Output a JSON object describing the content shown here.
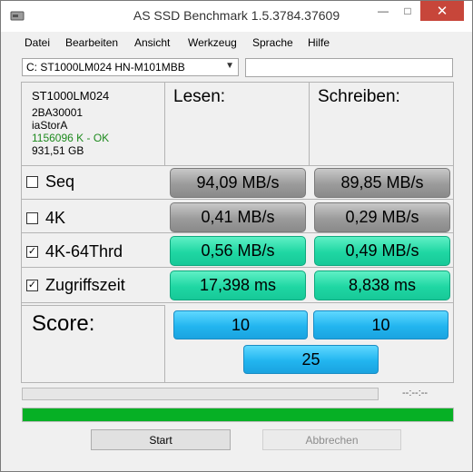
{
  "window": {
    "title": "AS SSD Benchmark 1.5.3784.37609"
  },
  "menu": [
    "Datei",
    "Bearbeiten",
    "Ansicht",
    "Werkzeug",
    "Sprache",
    "Hilfe"
  ],
  "drive_select": {
    "value": "C: ST1000LM024 HN-M101MBB"
  },
  "text_box": {
    "value": ""
  },
  "info": {
    "model": "ST1000LM024",
    "firmware": "2BA30001",
    "driver": "iaStorA",
    "alignment": "1156096 K - OK",
    "size": "931,51 GB"
  },
  "columns": {
    "read": "Lesen:",
    "write": "Schreiben:"
  },
  "rows": [
    {
      "label": "Seq",
      "checked": false,
      "read": "94,09 MB/s",
      "write": "89,85 MB/s",
      "style": "gray"
    },
    {
      "label": "4K",
      "checked": false,
      "read": "0,41 MB/s",
      "write": "0,29 MB/s",
      "style": "gray"
    },
    {
      "label": "4K-64Thrd",
      "checked": true,
      "read": "0,56 MB/s",
      "write": "0,49 MB/s",
      "style": "green"
    },
    {
      "label": "Zugriffszeit",
      "checked": true,
      "read": "17,398 ms",
      "write": "8,838 ms",
      "style": "green"
    }
  ],
  "score": {
    "label": "Score:",
    "read": "10",
    "write": "10",
    "total": "25"
  },
  "progress": {
    "time": "--:--:--",
    "bar1_fraction": 0,
    "bar2_fraction": 1
  },
  "buttons": {
    "start": "Start",
    "cancel": "Abbrechen"
  },
  "colors": {
    "accent_green": "#06b025",
    "result_green": "#1fd7a3",
    "score_blue": "#22b5ef",
    "alignment_ok": "#1e8a1e"
  },
  "icons": {
    "app": "drive-icon",
    "checkbox_checked": "check-mark"
  }
}
